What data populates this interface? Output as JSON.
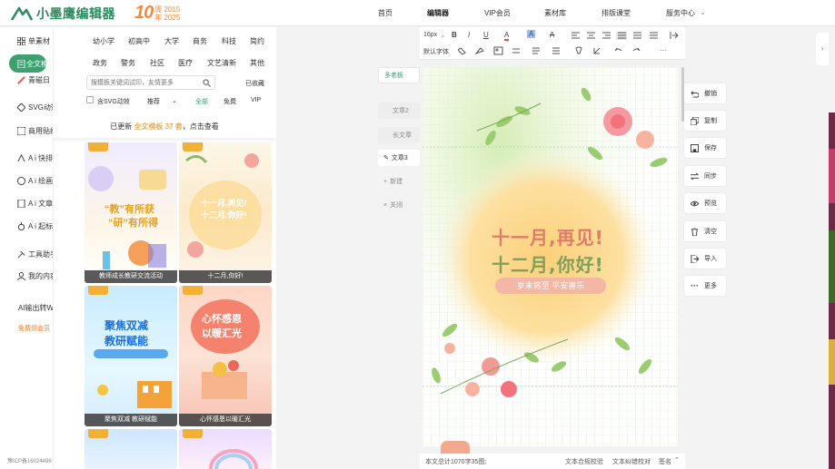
{
  "header": {
    "logo_text": "小墨鹰编辑器",
    "anniv_number": "10",
    "anniv_line1": "周 2015",
    "anniv_line2": "年 2025",
    "nav": [
      "首页",
      "编辑器",
      "VIP会员",
      "素材库",
      "排版课堂",
      "服务中心"
    ],
    "nav_active": 1
  },
  "leftnav": [
    {
      "label": "单素材",
      "icon": "grid-icon"
    },
    {
      "label": "全文模板",
      "icon": "document-icon",
      "active": true
    },
    {
      "label": "青磁日",
      "icon": "brush-icon"
    },
    {
      "label": "SVG动效",
      "icon": "svg-icon"
    },
    {
      "label": "商用贴纸",
      "icon": "sticker-icon"
    },
    {
      "label": "A i 快排",
      "icon": "ai-icon"
    },
    {
      "label": "A i 绘画",
      "icon": "palette-icon"
    },
    {
      "label": "A i 文章",
      "icon": "article-icon",
      "badge": "限免"
    },
    {
      "label": "A i 起标题",
      "icon": "title-icon"
    },
    {
      "label": "工具助手",
      "icon": "tool-icon"
    },
    {
      "label": "我的内容",
      "icon": "user-icon"
    },
    {
      "label": "AI输出转Word",
      "icon": ""
    },
    {
      "label": "免费领会员",
      "icon": ""
    }
  ],
  "footer_icp": "豫ICP备16024496号-1",
  "categories_row1": [
    "幼小学",
    "初高中",
    "大学",
    "商务",
    "科技",
    "简约"
  ],
  "categories_row2": [
    "政务",
    "警务",
    "社区",
    "医疗",
    "文艺清新",
    "其他"
  ],
  "search": {
    "placeholder": "搜模板关键词试印，友情更多",
    "collected": "已收藏"
  },
  "filters": {
    "svg": "含SVG动效",
    "recommend": "推荐",
    "all": "全部",
    "free": "免费",
    "vip": "VIP"
  },
  "update_notice": {
    "prefix": "已更新",
    "highlight": "全文模板 37 套",
    "suffix": "，点击查看"
  },
  "templates": [
    {
      "caption": "教师成长教研交流活动",
      "title1": "“教”有所获",
      "title2": "“研”有所得"
    },
    {
      "caption": "十二月,你好!",
      "title1": "十一月,再见!",
      "title2": "十二月,你好!"
    },
    {
      "caption": "聚焦双减 教研赋能",
      "title1": "聚焦双减",
      "title2": "教研赋能"
    },
    {
      "caption": "心怀感恩以暖汇光",
      "title1": "心怀感恩",
      "title2": "以暖汇光"
    }
  ],
  "doc_tabs": [
    "多老板",
    "文章2",
    "长文章",
    "文章3",
    "新建",
    "关闭"
  ],
  "toolbar": {
    "font_size": "16px",
    "font_family": "默认字体",
    "row1": [
      "B",
      "I",
      "U",
      "A",
      "A",
      "A"
    ],
    "more": "···"
  },
  "canvas": {
    "line1": "十一月,再见!",
    "line2": "十二月,你好!",
    "tagline": "岁末将至  平安喜乐"
  },
  "status": {
    "wordcount": "本文总计1070字35图;",
    "check1": "文本合规校验",
    "check2": "文本纠错校对",
    "sign": "签名"
  },
  "actions": [
    "撤销",
    "复制",
    "保存",
    "同步",
    "预览",
    "清空",
    "导入",
    "更多"
  ],
  "colors": {
    "brand": "#3da16f",
    "accent": "#f08a3c",
    "title_green": "#7fa05a",
    "title_red": "#e07b6a"
  }
}
